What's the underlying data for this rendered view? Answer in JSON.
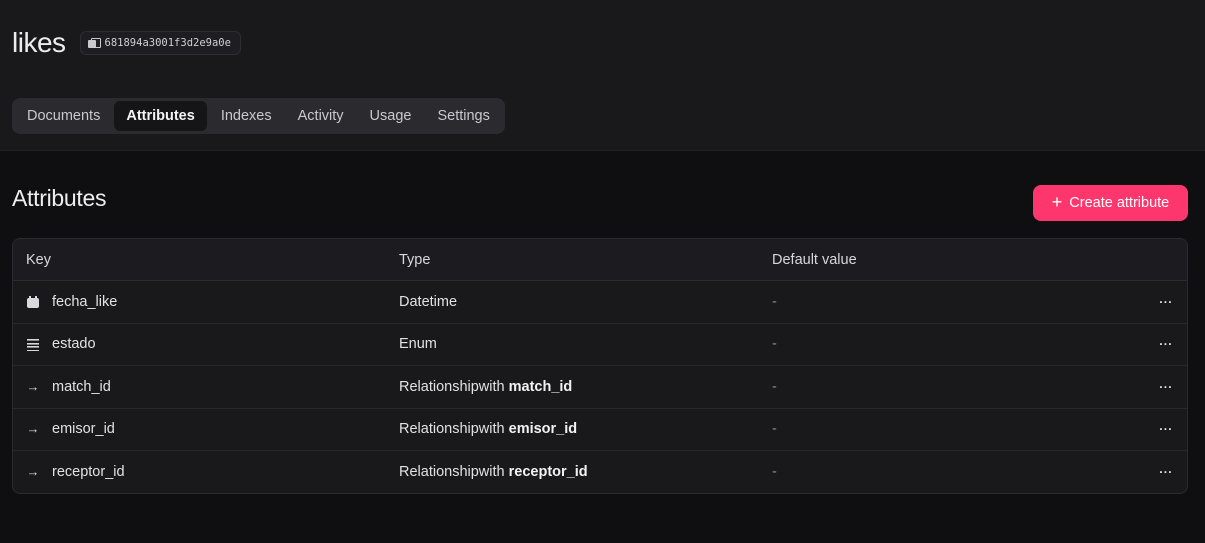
{
  "collection": {
    "name": "likes",
    "id": "681894a3001f3d2e9a0e"
  },
  "tabs": [
    {
      "label": "Documents"
    },
    {
      "label": "Attributes"
    },
    {
      "label": "Indexes"
    },
    {
      "label": "Activity"
    },
    {
      "label": "Usage"
    },
    {
      "label": "Settings"
    }
  ],
  "active_tab": "Attributes",
  "section": {
    "title": "Attributes",
    "create_label": "Create attribute",
    "create_icon": "plus-icon"
  },
  "table": {
    "columns": [
      "Key",
      "Type",
      "Default value"
    ],
    "rows": [
      {
        "icon": "calendar-icon",
        "key": "fecha_like",
        "type": "Datetime",
        "type_suffix": "",
        "default": "-"
      },
      {
        "icon": "enum-list-icon",
        "key": "estado",
        "type": "Enum",
        "type_suffix": "",
        "default": "-"
      },
      {
        "icon": "arrow-right-icon",
        "key": "match_id",
        "type": "Relationshipwith ",
        "type_suffix": "match_id",
        "default": "-"
      },
      {
        "icon": "arrow-right-icon",
        "key": "emisor_id",
        "type": "Relationshipwith ",
        "type_suffix": "emisor_id",
        "default": "-"
      },
      {
        "icon": "arrow-right-icon",
        "key": "receptor_id",
        "type": "Relationshipwith ",
        "type_suffix": "receptor_id",
        "default": "-"
      }
    ],
    "row_action_label": "···"
  },
  "colors": {
    "accent": "#fd366e",
    "header_bg": "#19191c",
    "page_bg": "#0f0f12"
  }
}
